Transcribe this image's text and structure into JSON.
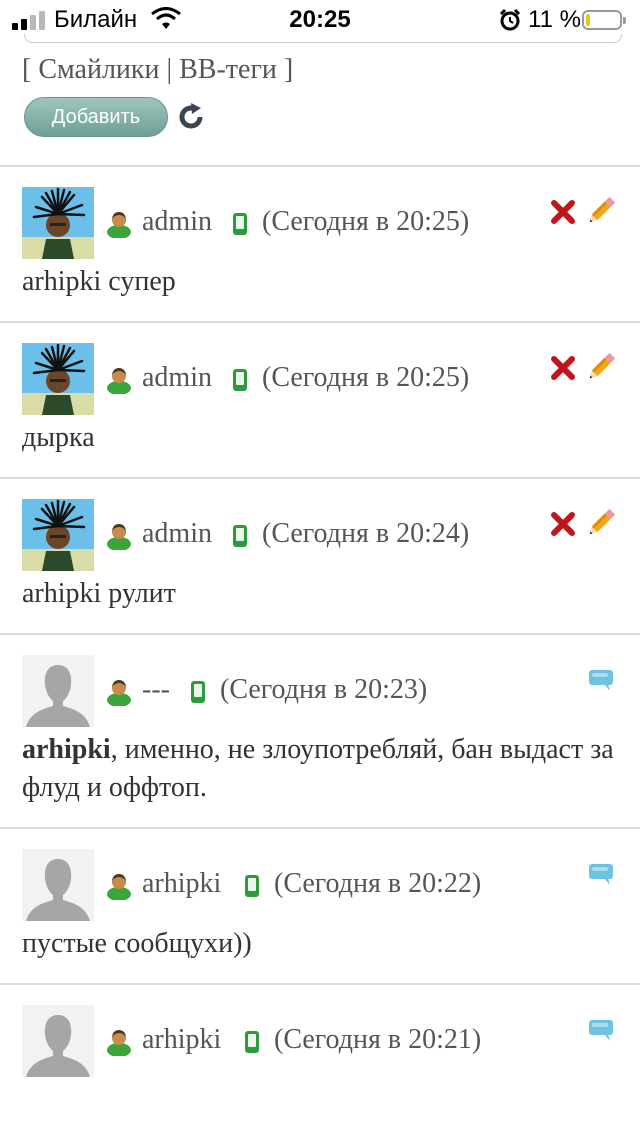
{
  "status_bar": {
    "carrier": "Билайн",
    "time": "20:25",
    "battery_pct": "11 %",
    "battery_level": 0.11
  },
  "form": {
    "links_open": "[ ",
    "smileys_label": "Смайлики",
    "separator": " | ",
    "bbcodes_label": "BB-теги",
    "links_close": " ]",
    "add_button": "Добавить"
  },
  "posts": [
    {
      "user": "admin",
      "time": "(Сегодня в 20:25)",
      "text": "arhipki супер",
      "avatar": "photo",
      "actions": [
        "delete-icon",
        "edit-icon"
      ]
    },
    {
      "user": "admin",
      "time": "(Сегодня в 20:25)",
      "text": "дырка",
      "avatar": "photo",
      "actions": [
        "delete-icon",
        "edit-icon"
      ]
    },
    {
      "user": "admin",
      "time": "(Сегодня в 20:24)",
      "text": "arhipki рулит",
      "avatar": "photo",
      "actions": [
        "delete-icon",
        "edit-icon"
      ]
    },
    {
      "user": "---",
      "time": "(Сегодня в 20:23)",
      "text_bold": "arhipki",
      "text": ", именно, не злоупотребляй, бан выдаст за флуд и оффтоп.",
      "avatar": "default",
      "actions": [
        "reply-icon"
      ]
    },
    {
      "user": "arhipki",
      "time": "(Сегодня в 20:22)",
      "text": "пустые сообщухи))",
      "avatar": "default",
      "actions": [
        "reply-icon"
      ]
    },
    {
      "user": "arhipki",
      "time": "(Сегодня в 20:21)",
      "text": "",
      "avatar": "default",
      "actions": [
        "reply-icon"
      ]
    }
  ],
  "colors": {
    "button": "#7fb0a6",
    "user_icon_body": "#3aa63a",
    "mobile_icon": "#2e9a3e",
    "delete": "#c0161b",
    "reply": "#6fc3e0"
  }
}
